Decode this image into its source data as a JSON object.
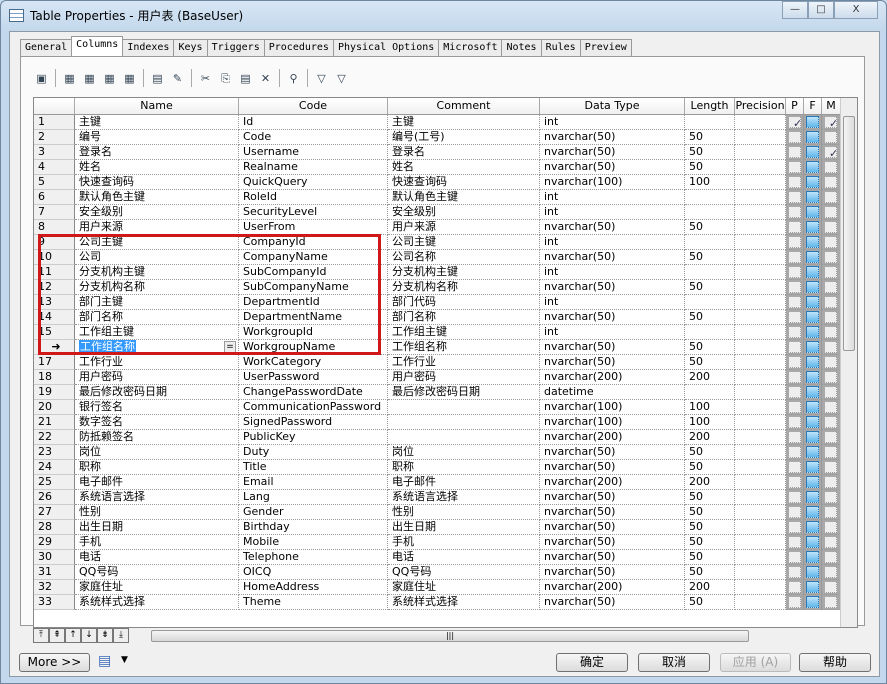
{
  "window": {
    "title": "Table Properties - 用户表 (BaseUser)",
    "minimize": "—",
    "maximize": "□",
    "close": "X"
  },
  "tabs": [
    "General",
    "Columns",
    "Indexes",
    "Keys",
    "Triggers",
    "Procedures",
    "Physical Options",
    "Microsoft",
    "Notes",
    "Rules",
    "Preview"
  ],
  "active_tab": "Columns",
  "toolbar": [
    "properties-icon",
    "add-row-icon",
    "insert-row-icon",
    "add-columns-icon",
    "replace-icon",
    "paste-icon",
    "clear-icon",
    "cut-icon",
    "copy-icon",
    "paste-clip-icon",
    "delete-icon",
    "find-icon",
    "filter-icon",
    "filter-check-icon"
  ],
  "headers": [
    "",
    "Name",
    "Code",
    "Comment",
    "Data Type",
    "Length",
    "Precision",
    "P",
    "F",
    "M"
  ],
  "current_row": 16,
  "rows": [
    [
      "1",
      "主键",
      "Id",
      "主键",
      "int",
      "",
      "",
      true,
      true
    ],
    [
      "2",
      "编号",
      "Code",
      "编号(工号)",
      "nvarchar(50)",
      "50",
      "",
      false,
      false
    ],
    [
      "3",
      "登录名",
      "Username",
      "登录名",
      "nvarchar(50)",
      "50",
      "",
      false,
      true
    ],
    [
      "4",
      "姓名",
      "Realname",
      "姓名",
      "nvarchar(50)",
      "50",
      "",
      false,
      false
    ],
    [
      "5",
      "快速查询码",
      "QuickQuery",
      "快速查询码",
      "nvarchar(100)",
      "100",
      "",
      false,
      false
    ],
    [
      "6",
      "默认角色主键",
      "RoleId",
      "默认角色主键",
      "int",
      "",
      "",
      false,
      false
    ],
    [
      "7",
      "安全级别",
      "SecurityLevel",
      "安全级别",
      "int",
      "",
      "",
      false,
      false
    ],
    [
      "8",
      "用户来源",
      "UserFrom",
      "用户来源",
      "nvarchar(50)",
      "50",
      "",
      false,
      false
    ],
    [
      "9",
      "公司主键",
      "CompanyId",
      "公司主键",
      "int",
      "",
      "",
      false,
      false
    ],
    [
      "10",
      "公司",
      "CompanyName",
      "公司名称",
      "nvarchar(50)",
      "50",
      "",
      false,
      false
    ],
    [
      "11",
      "分支机构主键",
      "SubCompanyId",
      "分支机构主键",
      "int",
      "",
      "",
      false,
      false
    ],
    [
      "12",
      "分支机构名称",
      "SubCompanyName",
      "分支机构名称",
      "nvarchar(50)",
      "50",
      "",
      false,
      false
    ],
    [
      "13",
      "部门主键",
      "DepartmentId",
      "部门代码",
      "int",
      "",
      "",
      false,
      false
    ],
    [
      "14",
      "部门名称",
      "DepartmentName",
      "部门名称",
      "nvarchar(50)",
      "50",
      "",
      false,
      false
    ],
    [
      "15",
      "工作组主键",
      "WorkgroupId",
      "工作组主键",
      "int",
      "",
      "",
      false,
      false
    ],
    [
      "16",
      "工作组名称",
      "WorkgroupName",
      "工作组名称",
      "nvarchar(50)",
      "50",
      "",
      false,
      false
    ],
    [
      "17",
      "工作行业",
      "WorkCategory",
      "工作行业",
      "nvarchar(50)",
      "50",
      "",
      false,
      false
    ],
    [
      "18",
      "用户密码",
      "UserPassword",
      "用户密码",
      "nvarchar(200)",
      "200",
      "",
      false,
      false
    ],
    [
      "19",
      "最后修改密码日期",
      "ChangePasswordDate",
      "最后修改密码日期",
      "datetime",
      "",
      "",
      false,
      false
    ],
    [
      "20",
      "银行签名",
      "CommunicationPassword",
      "",
      "nvarchar(100)",
      "100",
      "",
      false,
      false
    ],
    [
      "21",
      "数字签名",
      "SignedPassword",
      "",
      "nvarchar(100)",
      "100",
      "",
      false,
      false
    ],
    [
      "22",
      "防抵赖签名",
      "PublicKey",
      "",
      "nvarchar(200)",
      "200",
      "",
      false,
      false
    ],
    [
      "23",
      "岗位",
      "Duty",
      "岗位",
      "nvarchar(50)",
      "50",
      "",
      false,
      false
    ],
    [
      "24",
      "职称",
      "Title",
      "职称",
      "nvarchar(50)",
      "50",
      "",
      false,
      false
    ],
    [
      "25",
      "电子邮件",
      "Email",
      "电子邮件",
      "nvarchar(200)",
      "200",
      "",
      false,
      false
    ],
    [
      "26",
      "系统语言选择",
      "Lang",
      "系统语言选择",
      "nvarchar(50)",
      "50",
      "",
      false,
      false
    ],
    [
      "27",
      "性别",
      "Gender",
      "性别",
      "nvarchar(50)",
      "50",
      "",
      false,
      false
    ],
    [
      "28",
      "出生日期",
      "Birthday",
      "出生日期",
      "nvarchar(50)",
      "50",
      "",
      false,
      false
    ],
    [
      "29",
      "手机",
      "Mobile",
      "手机",
      "nvarchar(50)",
      "50",
      "",
      false,
      false
    ],
    [
      "30",
      "电话",
      "Telephone",
      "电话",
      "nvarchar(50)",
      "50",
      "",
      false,
      false
    ],
    [
      "31",
      "QQ号码",
      "OICQ",
      "QQ号码",
      "nvarchar(50)",
      "50",
      "",
      false,
      false
    ],
    [
      "32",
      "家庭住址",
      "HomeAddress",
      "家庭住址",
      "nvarchar(200)",
      "200",
      "",
      false,
      false
    ],
    [
      "33",
      "系统样式选择",
      "Theme",
      "系统样式选择",
      "nvarchar(50)",
      "50",
      "",
      false,
      false
    ]
  ],
  "nav_buttons": [
    "⤒",
    "⇞",
    "↑",
    "↓",
    "⇟",
    "⤓"
  ],
  "buttons": {
    "more": "More >>",
    "ok": "确定",
    "cancel": "取消",
    "apply": "应用 (A)",
    "help": "帮助"
  },
  "colors": {
    "highlight_box": "#d01818",
    "selection": "#3399ff"
  }
}
